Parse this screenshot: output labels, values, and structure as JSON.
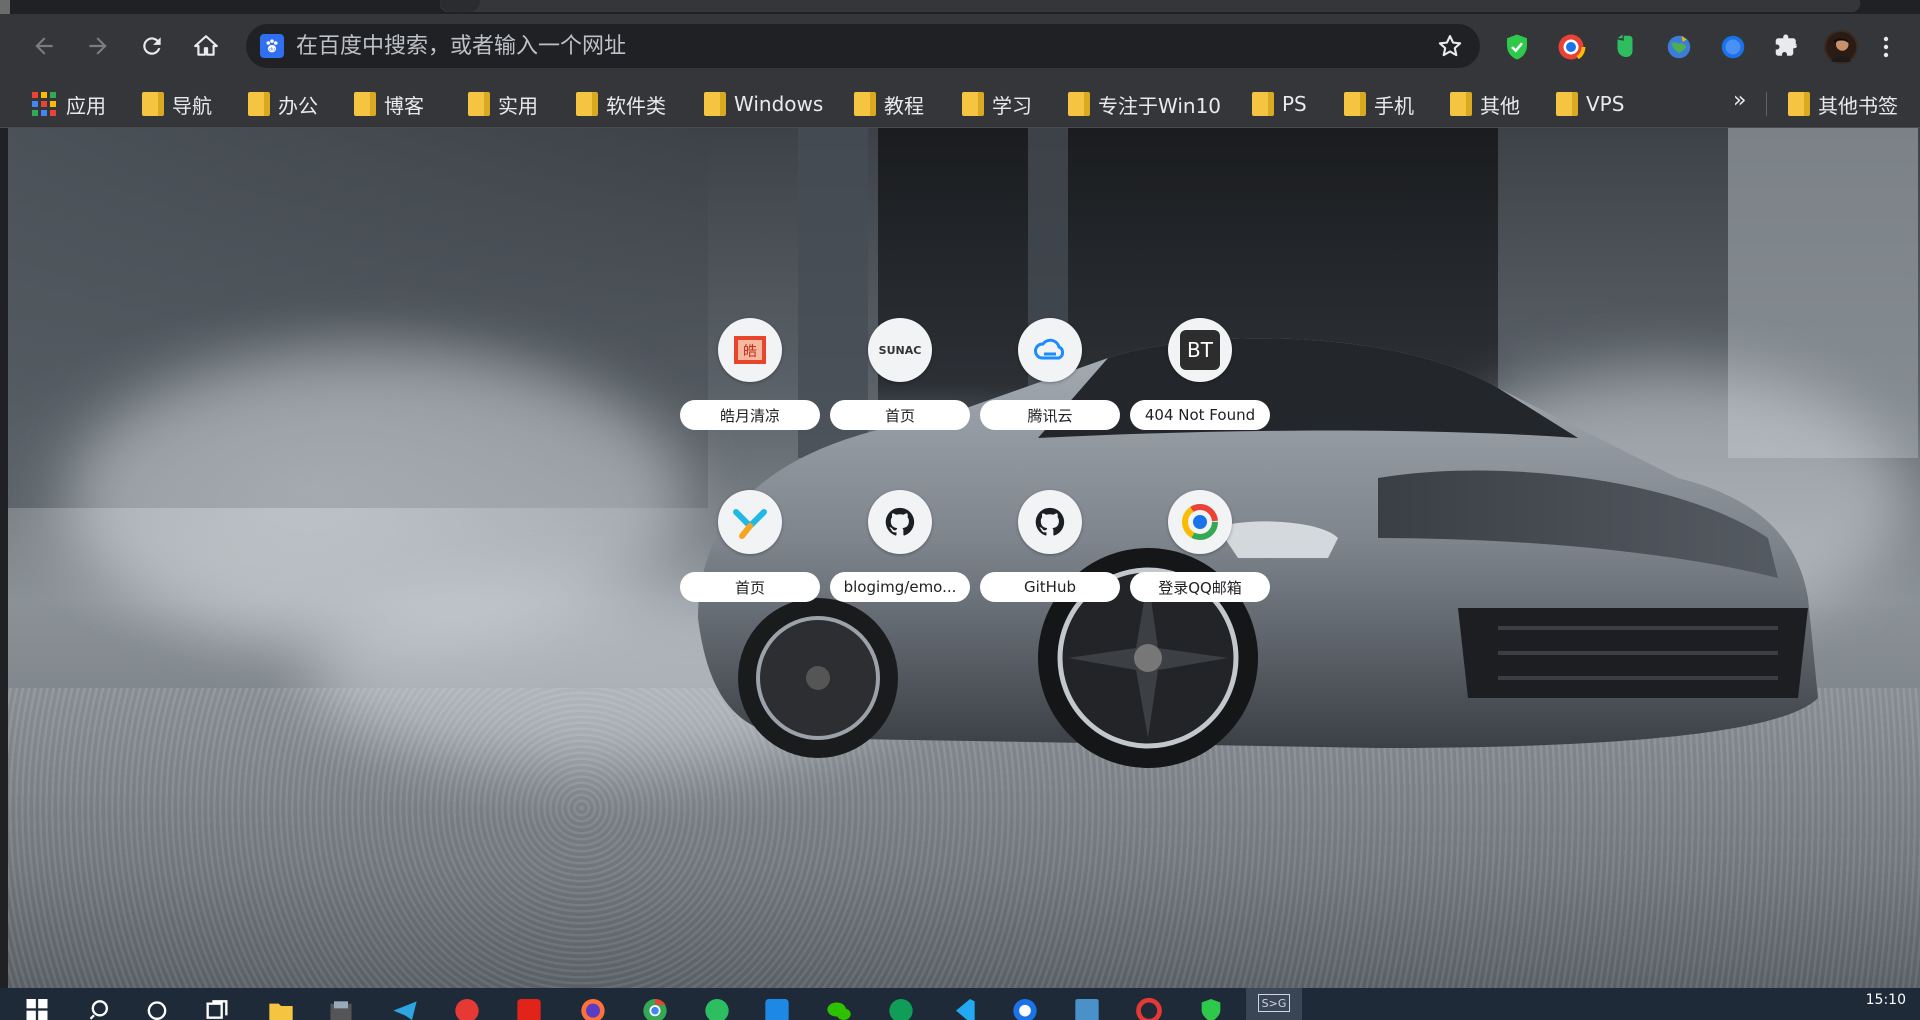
{
  "omnibox": {
    "placeholder": "在百度中搜索，或者输入一个网址",
    "favicon": "baidu-paw-icon"
  },
  "bookmarks": {
    "items": [
      {
        "label": "应用",
        "icon": "apps-grid-icon"
      },
      {
        "label": "导航",
        "icon": "folder-icon"
      },
      {
        "label": "办公",
        "icon": "folder-icon"
      },
      {
        "label": "博客",
        "icon": "folder-icon"
      },
      {
        "label": "实用",
        "icon": "folder-icon"
      },
      {
        "label": "软件类",
        "icon": "folder-icon"
      },
      {
        "label": "Windows",
        "icon": "folder-icon"
      },
      {
        "label": "教程",
        "icon": "folder-icon"
      },
      {
        "label": "学习",
        "icon": "folder-icon"
      },
      {
        "label": "专注于Win10",
        "icon": "folder-icon"
      },
      {
        "label": "PS",
        "icon": "folder-icon"
      },
      {
        "label": "手机",
        "icon": "folder-icon"
      },
      {
        "label": "其他",
        "icon": "folder-icon"
      },
      {
        "label": "VPS",
        "icon": "folder-icon"
      }
    ],
    "overflow": "»",
    "other": "其他书签"
  },
  "shortcuts": [
    {
      "label": "皓月清凉",
      "icon": "haoyue-icon"
    },
    {
      "label": "首页",
      "icon": "sunac-icon",
      "icon_text": "SUNAC"
    },
    {
      "label": "腾讯云",
      "icon": "tencent-cloud-icon"
    },
    {
      "label": "404 Not Found",
      "icon": "bt-icon",
      "icon_text": "BT"
    },
    {
      "label": "首页",
      "icon": "yuque-icon"
    },
    {
      "label": "blogimg/emo...",
      "icon": "github-icon"
    },
    {
      "label": "GitHub",
      "icon": "github-icon"
    },
    {
      "label": "登录QQ邮箱",
      "icon": "qq-mail-icon"
    }
  ],
  "taskbar": {
    "clock": "15:10",
    "active_app": "S>G"
  },
  "colors": {
    "chrome_toolbar": "#35363a",
    "omnibox": "#202124",
    "folder": "#f5c542",
    "taskbar": "#1e2a38"
  }
}
